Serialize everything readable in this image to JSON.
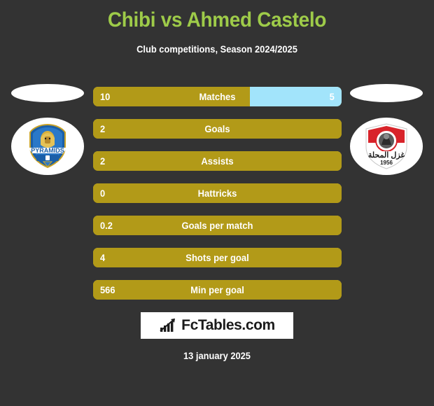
{
  "header": {
    "title": "Chibi vs Ahmed Castelo",
    "subtitle": "Club competitions, Season 2024/2025",
    "title_color": "#9ECB49"
  },
  "teams": {
    "home": {
      "crest_name": "pyramids-fc-crest",
      "crest_label": "PYRAMIDS"
    },
    "away": {
      "crest_name": "ghazl-el-mahalla-crest",
      "crest_label": "1956"
    }
  },
  "colors": {
    "background": "#333333",
    "bar_home": "#B29A18",
    "bar_away": "#A2E4FB",
    "text": "#ffffff",
    "accent": "#9ECB49"
  },
  "footer": {
    "brand": "FcTables.com",
    "date": "13 january 2025"
  },
  "chart_data": {
    "type": "bar",
    "title": "Chibi vs Ahmed Castelo",
    "subtitle": "Club competitions, Season 2024/2025",
    "orientation": "horizontal",
    "legend": [
      "Chibi",
      "Ahmed Castelo"
    ],
    "categories": [
      "Matches",
      "Goals",
      "Assists",
      "Hattricks",
      "Goals per match",
      "Shots per goal",
      "Min per goal"
    ],
    "series": [
      {
        "name": "Chibi",
        "values": [
          10,
          2,
          2,
          0,
          0.2,
          4,
          566
        ],
        "color": "#B29A18"
      },
      {
        "name": "Ahmed Castelo",
        "values": [
          5,
          null,
          null,
          null,
          null,
          null,
          null
        ],
        "color": "#A2E4FB"
      }
    ],
    "rows": [
      {
        "label": "Matches",
        "home": "10",
        "away": "5",
        "home_pct": 63,
        "away_pct": 37
      },
      {
        "label": "Goals",
        "home": "2",
        "away": "",
        "home_pct": 100,
        "away_pct": 0
      },
      {
        "label": "Assists",
        "home": "2",
        "away": "",
        "home_pct": 100,
        "away_pct": 0
      },
      {
        "label": "Hattricks",
        "home": "0",
        "away": "",
        "home_pct": 100,
        "away_pct": 0
      },
      {
        "label": "Goals per match",
        "home": "0.2",
        "away": "",
        "home_pct": 100,
        "away_pct": 0
      },
      {
        "label": "Shots per goal",
        "home": "4",
        "away": "",
        "home_pct": 100,
        "away_pct": 0
      },
      {
        "label": "Min per goal",
        "home": "566",
        "away": "",
        "home_pct": 100,
        "away_pct": 0
      }
    ]
  }
}
